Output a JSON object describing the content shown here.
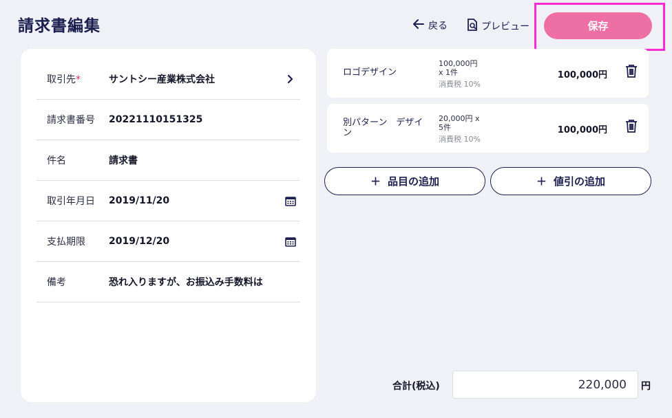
{
  "header": {
    "title": "請求書編集",
    "back_label": "戻る",
    "preview_label": "プレビュー",
    "save_label": "保存",
    "accent_color": "#ee6fa3",
    "highlight_color": "#ff2bd6"
  },
  "form": {
    "fields": [
      {
        "label": "取引先",
        "required_mark": "*",
        "value": "サントシー産業株式会社",
        "icon": "chevron-right-icon"
      },
      {
        "label": "請求書番号",
        "value": "20221110151325"
      },
      {
        "label": "件名",
        "value": "請求書"
      },
      {
        "label": "取引年月日",
        "value": "2019/11/20",
        "icon": "calendar-icon"
      },
      {
        "label": "支払期限",
        "value": "2019/12/20",
        "icon": "calendar-icon"
      },
      {
        "label": "備考",
        "value": "恐れ入りますが、お振込み手数料は"
      }
    ]
  },
  "items": [
    {
      "name": "ロゴデザイン",
      "qty_line1": "100,000円",
      "qty_line2": "x 1件",
      "tax": "消費税 10%",
      "amount": "100,000円"
    },
    {
      "name_line1": "別パターン　デザイ",
      "name_line2": "ン",
      "qty_line1": "20,000円 x",
      "qty_line2": "5件",
      "tax": "消費税 10%",
      "amount": "100,000円"
    }
  ],
  "actions": {
    "add_item_label": "品目の追加",
    "add_discount_label": "値引の追加",
    "plus": "＋"
  },
  "total": {
    "label": "合計(税込)",
    "value": "220,000",
    "unit": "円"
  }
}
